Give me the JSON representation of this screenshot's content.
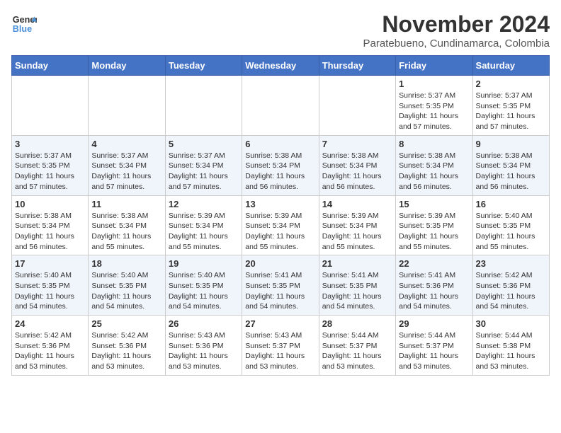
{
  "header": {
    "logo_line1": "General",
    "logo_line2": "Blue",
    "month": "November 2024",
    "location": "Paratebueno, Cundinamarca, Colombia"
  },
  "days_of_week": [
    "Sunday",
    "Monday",
    "Tuesday",
    "Wednesday",
    "Thursday",
    "Friday",
    "Saturday"
  ],
  "weeks": [
    [
      {
        "day": "",
        "info": ""
      },
      {
        "day": "",
        "info": ""
      },
      {
        "day": "",
        "info": ""
      },
      {
        "day": "",
        "info": ""
      },
      {
        "day": "",
        "info": ""
      },
      {
        "day": "1",
        "info": "Sunrise: 5:37 AM\nSunset: 5:35 PM\nDaylight: 11 hours\nand 57 minutes."
      },
      {
        "day": "2",
        "info": "Sunrise: 5:37 AM\nSunset: 5:35 PM\nDaylight: 11 hours\nand 57 minutes."
      }
    ],
    [
      {
        "day": "3",
        "info": "Sunrise: 5:37 AM\nSunset: 5:35 PM\nDaylight: 11 hours\nand 57 minutes."
      },
      {
        "day": "4",
        "info": "Sunrise: 5:37 AM\nSunset: 5:34 PM\nDaylight: 11 hours\nand 57 minutes."
      },
      {
        "day": "5",
        "info": "Sunrise: 5:37 AM\nSunset: 5:34 PM\nDaylight: 11 hours\nand 57 minutes."
      },
      {
        "day": "6",
        "info": "Sunrise: 5:38 AM\nSunset: 5:34 PM\nDaylight: 11 hours\nand 56 minutes."
      },
      {
        "day": "7",
        "info": "Sunrise: 5:38 AM\nSunset: 5:34 PM\nDaylight: 11 hours\nand 56 minutes."
      },
      {
        "day": "8",
        "info": "Sunrise: 5:38 AM\nSunset: 5:34 PM\nDaylight: 11 hours\nand 56 minutes."
      },
      {
        "day": "9",
        "info": "Sunrise: 5:38 AM\nSunset: 5:34 PM\nDaylight: 11 hours\nand 56 minutes."
      }
    ],
    [
      {
        "day": "10",
        "info": "Sunrise: 5:38 AM\nSunset: 5:34 PM\nDaylight: 11 hours\nand 56 minutes."
      },
      {
        "day": "11",
        "info": "Sunrise: 5:38 AM\nSunset: 5:34 PM\nDaylight: 11 hours\nand 55 minutes."
      },
      {
        "day": "12",
        "info": "Sunrise: 5:39 AM\nSunset: 5:34 PM\nDaylight: 11 hours\nand 55 minutes."
      },
      {
        "day": "13",
        "info": "Sunrise: 5:39 AM\nSunset: 5:34 PM\nDaylight: 11 hours\nand 55 minutes."
      },
      {
        "day": "14",
        "info": "Sunrise: 5:39 AM\nSunset: 5:34 PM\nDaylight: 11 hours\nand 55 minutes."
      },
      {
        "day": "15",
        "info": "Sunrise: 5:39 AM\nSunset: 5:35 PM\nDaylight: 11 hours\nand 55 minutes."
      },
      {
        "day": "16",
        "info": "Sunrise: 5:40 AM\nSunset: 5:35 PM\nDaylight: 11 hours\nand 55 minutes."
      }
    ],
    [
      {
        "day": "17",
        "info": "Sunrise: 5:40 AM\nSunset: 5:35 PM\nDaylight: 11 hours\nand 54 minutes."
      },
      {
        "day": "18",
        "info": "Sunrise: 5:40 AM\nSunset: 5:35 PM\nDaylight: 11 hours\nand 54 minutes."
      },
      {
        "day": "19",
        "info": "Sunrise: 5:40 AM\nSunset: 5:35 PM\nDaylight: 11 hours\nand 54 minutes."
      },
      {
        "day": "20",
        "info": "Sunrise: 5:41 AM\nSunset: 5:35 PM\nDaylight: 11 hours\nand 54 minutes."
      },
      {
        "day": "21",
        "info": "Sunrise: 5:41 AM\nSunset: 5:35 PM\nDaylight: 11 hours\nand 54 minutes."
      },
      {
        "day": "22",
        "info": "Sunrise: 5:41 AM\nSunset: 5:36 PM\nDaylight: 11 hours\nand 54 minutes."
      },
      {
        "day": "23",
        "info": "Sunrise: 5:42 AM\nSunset: 5:36 PM\nDaylight: 11 hours\nand 54 minutes."
      }
    ],
    [
      {
        "day": "24",
        "info": "Sunrise: 5:42 AM\nSunset: 5:36 PM\nDaylight: 11 hours\nand 53 minutes."
      },
      {
        "day": "25",
        "info": "Sunrise: 5:42 AM\nSunset: 5:36 PM\nDaylight: 11 hours\nand 53 minutes."
      },
      {
        "day": "26",
        "info": "Sunrise: 5:43 AM\nSunset: 5:36 PM\nDaylight: 11 hours\nand 53 minutes."
      },
      {
        "day": "27",
        "info": "Sunrise: 5:43 AM\nSunset: 5:37 PM\nDaylight: 11 hours\nand 53 minutes."
      },
      {
        "day": "28",
        "info": "Sunrise: 5:44 AM\nSunset: 5:37 PM\nDaylight: 11 hours\nand 53 minutes."
      },
      {
        "day": "29",
        "info": "Sunrise: 5:44 AM\nSunset: 5:37 PM\nDaylight: 11 hours\nand 53 minutes."
      },
      {
        "day": "30",
        "info": "Sunrise: 5:44 AM\nSunset: 5:38 PM\nDaylight: 11 hours\nand 53 minutes."
      }
    ]
  ]
}
